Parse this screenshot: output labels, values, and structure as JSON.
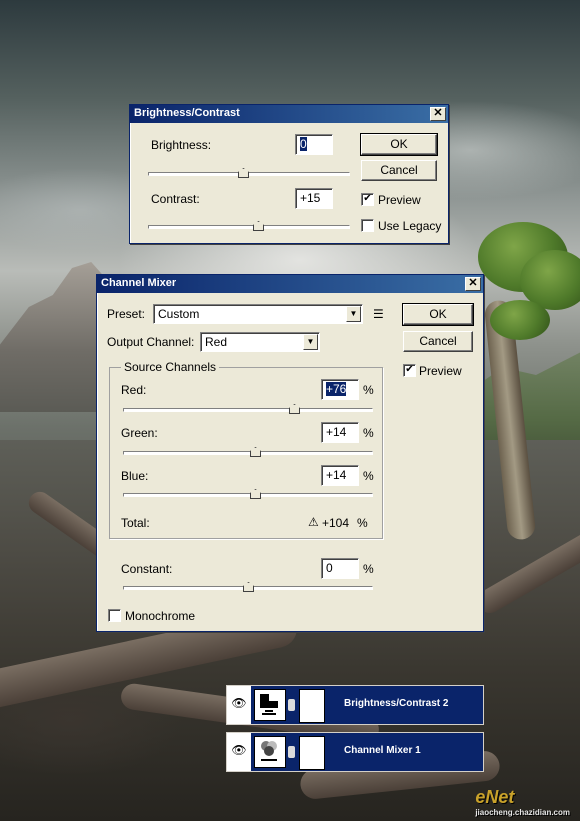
{
  "brightness_contrast": {
    "title": "Brightness/Contrast",
    "brightness_label": "Brightness:",
    "brightness_value": "0",
    "contrast_label": "Contrast:",
    "contrast_value": "+15",
    "ok": "OK",
    "cancel": "Cancel",
    "preview_label": "Preview",
    "preview_checked": true,
    "use_legacy_label": "Use Legacy",
    "use_legacy_checked": false,
    "close_glyph": "✕"
  },
  "channel_mixer": {
    "title": "Channel Mixer",
    "preset_label": "Preset:",
    "preset_value": "Custom",
    "output_label": "Output Channel:",
    "output_value": "Red",
    "ok": "OK",
    "cancel": "Cancel",
    "preview_label": "Preview",
    "preview_checked": true,
    "source_title": "Source Channels",
    "red_label": "Red:",
    "red_value": "+76",
    "green_label": "Green:",
    "green_value": "+14",
    "blue_label": "Blue:",
    "blue_value": "+14",
    "percent": "%",
    "total_label": "Total:",
    "total_value": "+104",
    "constant_label": "Constant:",
    "constant_value": "0",
    "monochrome_label": "Monochrome",
    "monochrome_checked": false,
    "close_glyph": "✕",
    "warning_glyph": "⚠",
    "menu_glyph": "☰"
  },
  "layers": [
    {
      "name": "Brightness/Contrast 2",
      "icon": "brightness-contrast-icon"
    },
    {
      "name": "Channel Mixer 1",
      "icon": "channel-mixer-icon"
    }
  ],
  "watermark": {
    "main": "eNet",
    "sub": "jiaocheng.chazidian.com"
  }
}
